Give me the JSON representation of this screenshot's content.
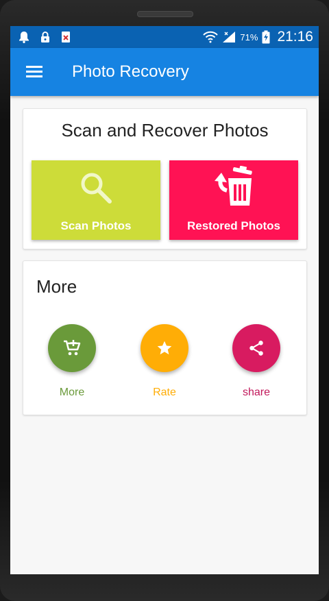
{
  "status_bar": {
    "battery_percent": "71%",
    "time": "21:16",
    "icons": [
      "notification-bell-icon",
      "lock-icon",
      "error-notification-icon",
      "wifi-icon",
      "signal-icon",
      "battery-charging-icon"
    ]
  },
  "app_bar": {
    "title": "Photo Recovery",
    "menu_icon": "hamburger-menu-icon"
  },
  "scan_card": {
    "title": "Scan and Recover Photos",
    "scan_button": {
      "label": "Scan Photos",
      "icon": "search-icon",
      "color": "#cddc39"
    },
    "restored_button": {
      "label": "Restored Photos",
      "icon": "restore-trash-icon",
      "color": "#ff1254"
    }
  },
  "more_card": {
    "title": "More",
    "actions": [
      {
        "label": "More",
        "icon": "add-cart-icon",
        "color": "#6a9a3a"
      },
      {
        "label": "Rate",
        "icon": "star-icon",
        "color": "#ffad06"
      },
      {
        "label": "share",
        "icon": "share-icon",
        "color": "#d81b60"
      }
    ]
  }
}
